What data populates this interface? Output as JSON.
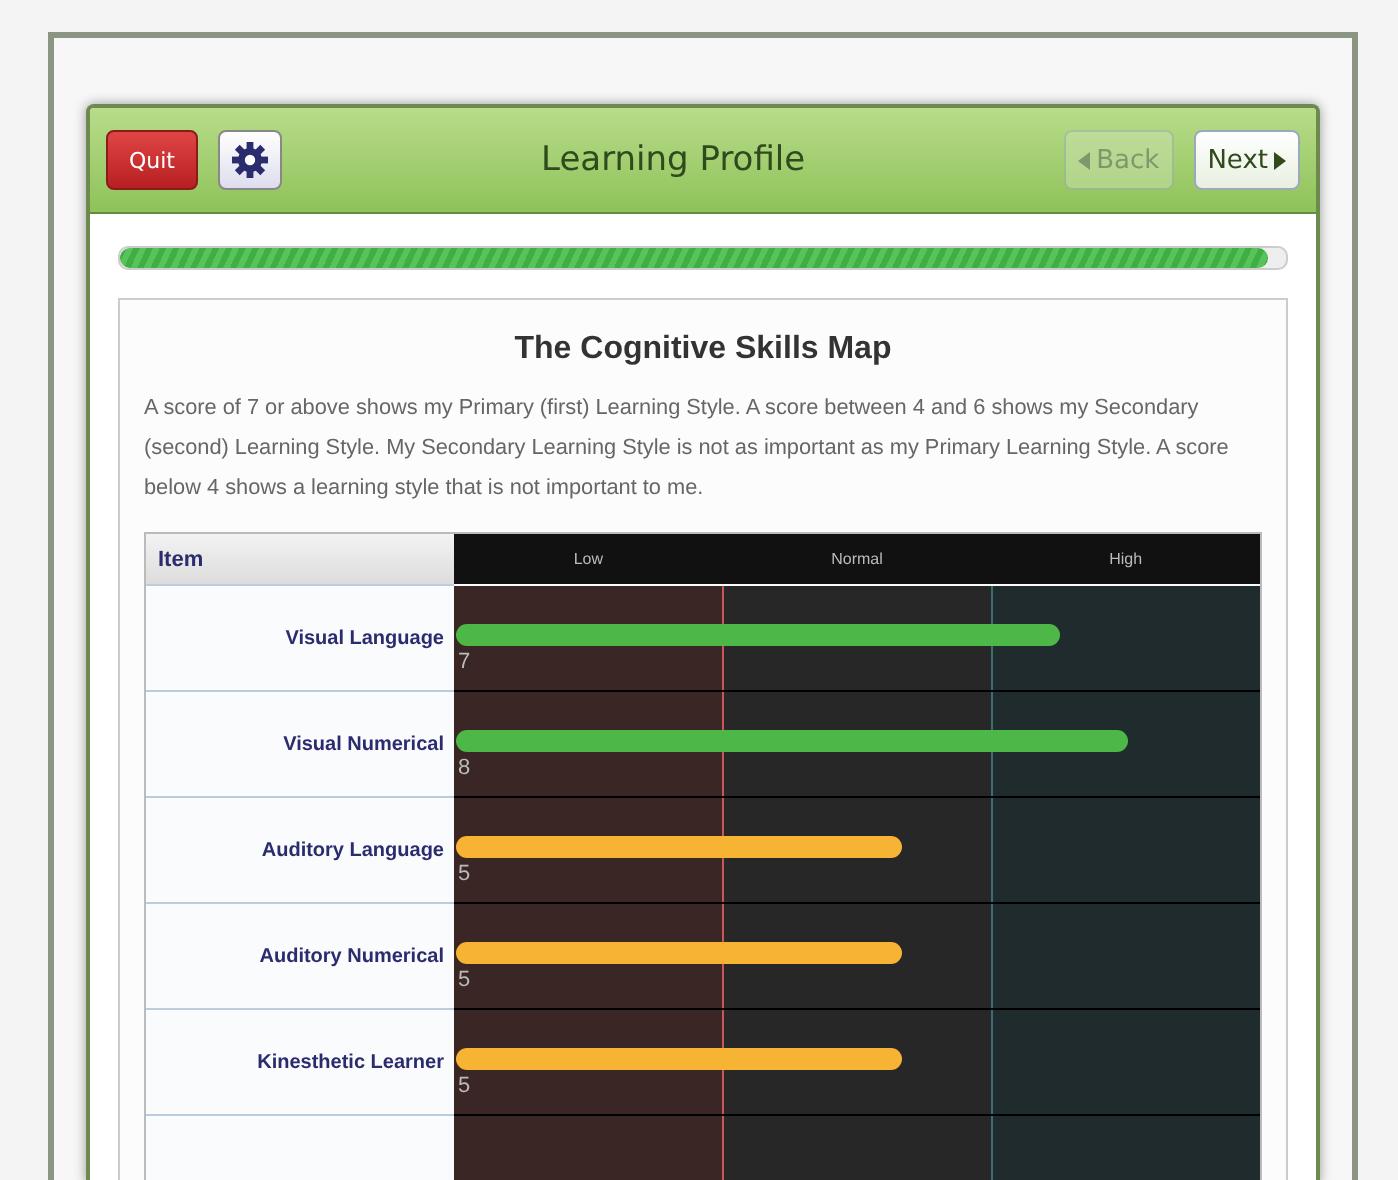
{
  "header": {
    "quit": "Quit",
    "title": "Learning Profile",
    "back": {
      "label": "Back",
      "disabled": true
    },
    "next": {
      "label": "Next",
      "disabled": false
    }
  },
  "progress": {
    "level": 0.985
  },
  "panel": {
    "title": "The Cognitive Skills Map",
    "description": "A score of 7 or above shows my Primary (first) Learning Style. A score between 4 and 6 shows my Secondary (second) Learning Style. My Secondary Learning Style is not as important as my Primary Learning Style. A score below 4 shows a learning style that is not important to me.",
    "table": {
      "item_header": "Item",
      "bands": [
        "Low",
        "Normal",
        "High"
      ],
      "rows": [
        {
          "name": "Visual Language",
          "score": "7",
          "level": 0.75,
          "color": "#4db848"
        },
        {
          "name": "Visual Numerical",
          "score": "8",
          "level": 0.835,
          "color": "#4db848"
        },
        {
          "name": "Auditory Language",
          "score": "5",
          "level": 0.555,
          "color": "#f7b334"
        },
        {
          "name": "Auditory Numerical",
          "score": "5",
          "level": 0.555,
          "color": "#f7b334"
        },
        {
          "name": "Kinesthetic Learner",
          "score": "5",
          "level": 0.555,
          "color": "#f7b334"
        }
      ]
    }
  }
}
